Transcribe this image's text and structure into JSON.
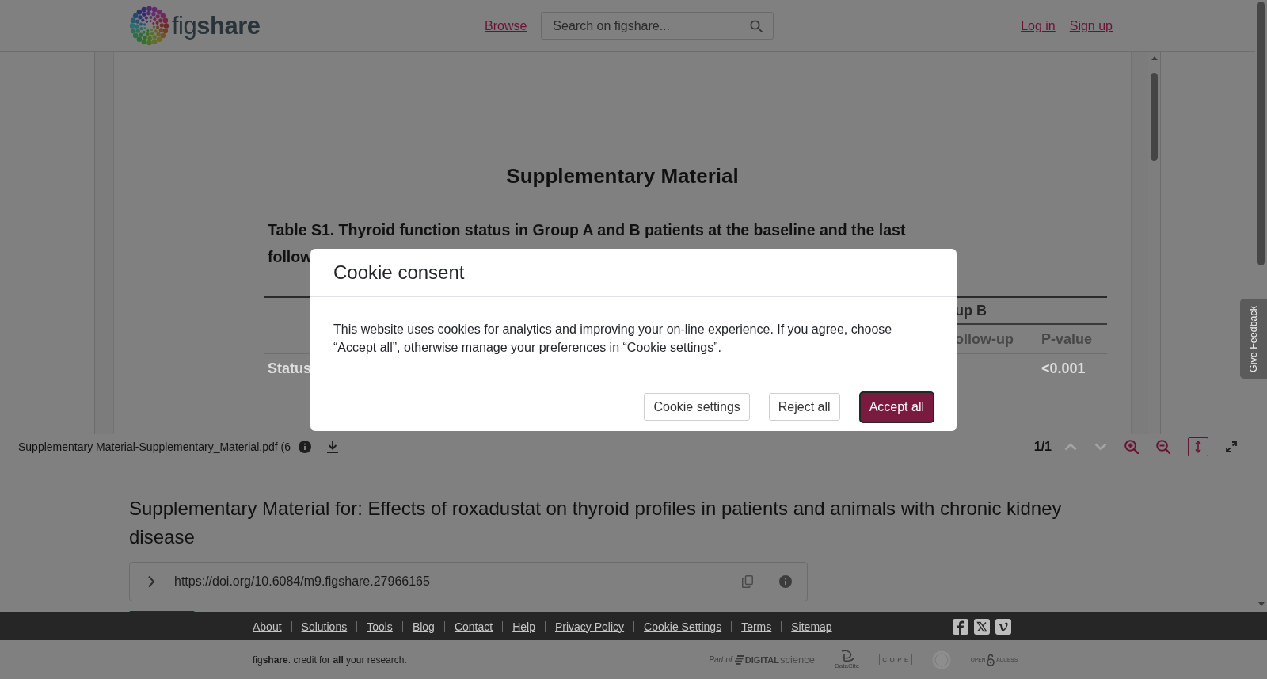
{
  "header": {
    "logo_text": "fig**share**",
    "browse_link": "Browse",
    "search": {
      "placeholder": "Search on figshare..."
    },
    "auth_links": [
      "Log in",
      "Sign up"
    ]
  },
  "viewer": {
    "document": {
      "heading": "Supplementary Material",
      "caption_lines": [
        "Table S1. Thyroid function status in Group A and B patients at the baseline and the last",
        "follow"
      ],
      "table": {
        "group_header": "up B",
        "column_headers": [
          "ollow-up",
          "P-value"
        ],
        "rows": [
          {
            "label": "Status",
            "p_value": "<0.001"
          }
        ]
      }
    },
    "toolbar": {
      "file_name": "Supplementary Material-Supplementary_Material.pdf (6",
      "page_indicator": "1/1",
      "controls": [
        {
          "kind": "previous-page",
          "disabled": true,
          "selected": false
        },
        {
          "kind": "next-page",
          "disabled": true,
          "selected": false
        },
        {
          "kind": "zoom-in",
          "disabled": false,
          "selected": false
        },
        {
          "kind": "zoom-out",
          "disabled": false,
          "selected": false
        },
        {
          "kind": "fit-height",
          "disabled": false,
          "selected": true
        },
        {
          "kind": "fullscreen",
          "disabled": false,
          "selected": false
        }
      ]
    }
  },
  "item": {
    "title": "Supplementary Material for: Effects of roxadustat on thyroid profiles in patients and animals with chronic kidney disease",
    "doi_url": "https://doi.org/10.6084/m9.figshare.27966165"
  },
  "footer": {
    "links": [
      "About",
      "Solutions",
      "Tools",
      "Blog",
      "Contact",
      "Help",
      "Privacy Policy",
      "Cookie Settings",
      "Terms",
      "Sitemap"
    ],
    "tagline": "fig**share**. credit for **all** your research.",
    "partners": [
      {
        "kind": "digital-science",
        "texts": [
          "Part of",
          "DIGITAL",
          "science"
        ]
      },
      {
        "kind": "datacite",
        "texts": [
          "DataCite"
        ]
      },
      {
        "kind": "cope",
        "texts": [
          "COPE"
        ]
      },
      {
        "kind": "seal"
      },
      {
        "kind": "open-access",
        "texts": [
          "OPEN",
          "ACCESS"
        ]
      }
    ]
  },
  "feedback_tab": "Give Feedback",
  "cookie_dialog": {
    "title": "Cookie consent",
    "message": "This website uses cookies for analytics and improving your on-line experience. If you agree, choose “Accept all”, otherwise manage your preferences in “Cookie settings”.",
    "buttons": [
      {
        "label": "Cookie settings",
        "kind": "settings",
        "focused": false
      },
      {
        "label": "Reject all",
        "kind": "reject",
        "focused": false
      },
      {
        "label": "Accept all",
        "kind": "accept",
        "focused": true
      }
    ]
  }
}
